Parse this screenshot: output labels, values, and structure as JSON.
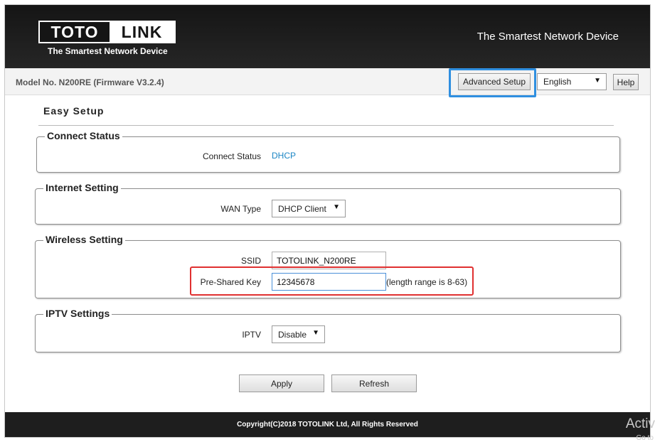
{
  "header": {
    "logo_left": "TOTO",
    "logo_right": "LINK",
    "logo_tagline": "The Smartest Network Device",
    "slogan": "The Smartest Network Device"
  },
  "topbar": {
    "model": "Model No. N200RE (Firmware V3.2.4)",
    "advanced_setup": "Advanced Setup",
    "language": "English",
    "help": "Help"
  },
  "page": {
    "title": "Easy Setup"
  },
  "connect_status": {
    "legend": "Connect Status",
    "label": "Connect Status",
    "value": "DHCP"
  },
  "internet": {
    "legend": "Internet Setting",
    "wan_label": "WAN Type",
    "wan_value": "DHCP Client"
  },
  "wireless": {
    "legend": "Wireless Setting",
    "ssid_label": "SSID",
    "ssid_value": "TOTOLINK_N200RE",
    "psk_label": "Pre-Shared Key",
    "psk_value": "12345678",
    "psk_hint": "(length range is 8-63)"
  },
  "iptv": {
    "legend": "IPTV Settings",
    "label": "IPTV",
    "value": "Disable"
  },
  "actions": {
    "apply": "Apply",
    "refresh": "Refresh"
  },
  "footer": {
    "copyright": "Copyright(C)2018 TOTOLINK Ltd, All Rights Reserved"
  },
  "overlay": {
    "text": "Activ",
    "sub": "Go to"
  }
}
